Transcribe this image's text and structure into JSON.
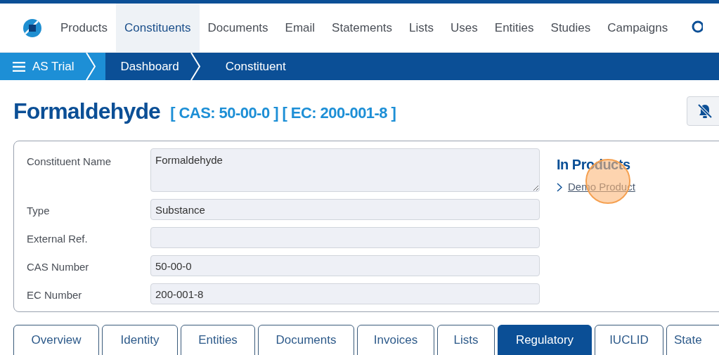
{
  "nav": {
    "items": [
      {
        "label": "Products",
        "selected": false
      },
      {
        "label": "Constituents",
        "selected": true
      },
      {
        "label": "Documents",
        "selected": false
      },
      {
        "label": "Email",
        "selected": false
      },
      {
        "label": "Statements",
        "selected": false
      },
      {
        "label": "Lists",
        "selected": false
      },
      {
        "label": "Uses",
        "selected": false
      },
      {
        "label": "Entities",
        "selected": false
      },
      {
        "label": "Studies",
        "selected": false
      },
      {
        "label": "Campaigns",
        "selected": false
      }
    ]
  },
  "breadcrumb": [
    "AS Trial",
    "Dashboard",
    "Constituent"
  ],
  "title": "Formaldehyde",
  "subtitle": "[ CAS: 50-00-0 ] [ EC: 200-001-8 ]",
  "fields": [
    {
      "label": "Constituent Name",
      "value": "Formaldehyde",
      "kind": "textarea"
    },
    {
      "label": "Type",
      "value": "Substance",
      "kind": "input"
    },
    {
      "label": "External Ref.",
      "kind": "input"
    },
    {
      "label": "CAS Number",
      "value": "50-00-0",
      "kind": "input"
    },
    {
      "label": "EC Number",
      "value": "200-001-8",
      "kind": "input"
    }
  ],
  "in_products": {
    "heading": "In Products",
    "links": [
      "Demo Product"
    ]
  },
  "tabs": [
    {
      "label": "Overview",
      "selected": false
    },
    {
      "label": "Identity",
      "selected": false
    },
    {
      "label": "Entities",
      "selected": false
    },
    {
      "label": "Documents",
      "selected": false
    },
    {
      "label": "Invoices",
      "selected": false
    },
    {
      "label": "Lists",
      "selected": false
    },
    {
      "label": "Regulatory",
      "selected": true
    },
    {
      "label": "IUCLID",
      "selected": false
    },
    {
      "label": "State",
      "selected": false
    }
  ]
}
